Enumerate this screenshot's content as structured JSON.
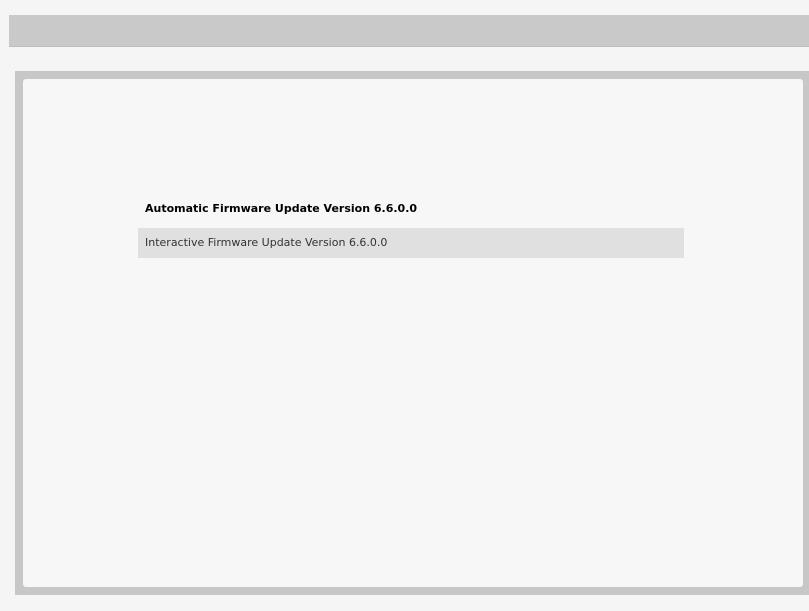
{
  "menu": {
    "items": [
      {
        "label": "Automatic Firmware Update Version 6.6.0.0"
      },
      {
        "label": "Interactive Firmware Update Version 6.6.0.0"
      }
    ]
  },
  "colors": {
    "top_bar": "#c9c9c9",
    "frame": "#c7c7c7",
    "panel": "#f7f7f7",
    "highlight": "#e0e0e0"
  }
}
